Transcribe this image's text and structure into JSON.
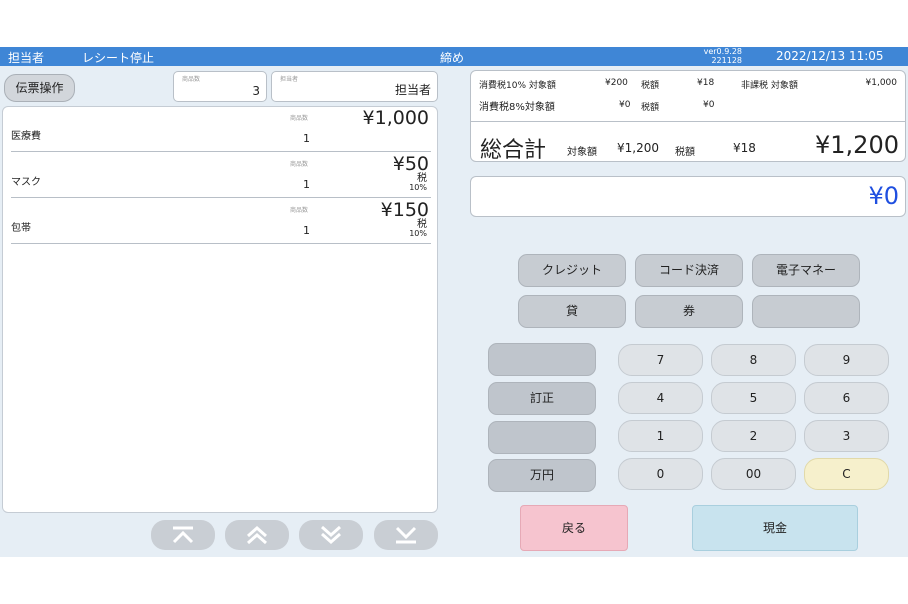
{
  "header": {
    "staff": "担当者",
    "receipt_suspend": "レシート停止",
    "mode": "締め",
    "version_line1": "ver0.9.28",
    "version_line2": "221128",
    "datetime": "2022/12/13  11:05"
  },
  "left": {
    "slip_button": "伝票操作",
    "count_label": "商品数",
    "count_value": "3",
    "staff_label": "担当者",
    "staff_value": "担当者",
    "qty_label": "商品数",
    "items": [
      {
        "name": "医療費",
        "qty": "1",
        "price": "¥1,000",
        "tax_mark": "",
        "tax_rate": ""
      },
      {
        "name": "マスク",
        "qty": "1",
        "price": "¥50",
        "tax_mark": "税",
        "tax_rate": "10%"
      },
      {
        "name": "包帯",
        "qty": "1",
        "price": "¥150",
        "tax_mark": "税",
        "tax_rate": "10%"
      }
    ],
    "pager_icons": [
      "scroll-top-icon",
      "page-up-icon",
      "page-down-icon",
      "scroll-bottom-icon"
    ]
  },
  "summary": {
    "tax10_label": "消費税10% 対象額",
    "tax10_base": "¥200",
    "tax10_tax_label": "税額",
    "tax10_tax": "¥18",
    "nontax_label": "非課税 対象額",
    "nontax_base": "¥1,000",
    "tax8_label": "消費税8%対象額",
    "tax8_base": "¥0",
    "tax8_tax_label": "税額",
    "tax8_tax": "¥0",
    "grand_label": "総合計",
    "grand_base_label": "対象額",
    "grand_base": "¥1,200",
    "grand_tax_label": "税額",
    "grand_tax": "¥18",
    "grand_total": "¥1,200",
    "paid_amount": "¥0"
  },
  "payment_buttons": {
    "credit": "クレジット",
    "code": "コード決済",
    "emoney": "電子マネー",
    "loan": "貸",
    "voucher": "券",
    "blank": ""
  },
  "keypad": {
    "side": [
      "",
      "訂正",
      "",
      "万円"
    ],
    "keys": [
      "7",
      "8",
      "9",
      "4",
      "5",
      "6",
      "1",
      "2",
      "3",
      "0",
      "00",
      "C"
    ]
  },
  "actions": {
    "back": "戻る",
    "cash": "現金"
  },
  "colors": {
    "header": "#3f86d6",
    "amount": "#1f4fe0",
    "back": "#f6c4cf",
    "cash": "#c8e3ee",
    "clear": "#f6f0cc"
  }
}
